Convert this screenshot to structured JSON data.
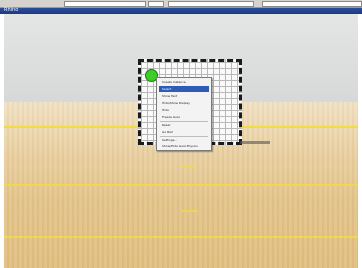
{
  "window": {
    "title": "Rhino"
  },
  "context_menu": {
    "items": [
      {
        "label": "Create Instance"
      },
      {
        "label": "Select"
      },
      {
        "label": "Show Text"
      },
      {
        "label": "Hide/Show Display"
      },
      {
        "label": "Hide"
      },
      {
        "label": "Freeze Goal"
      },
      {
        "label": "Reset"
      },
      {
        "label": "Go Ball"
      },
      {
        "label": "Settings..."
      },
      {
        "label": "Show/Hide Goal Physics"
      }
    ],
    "selected_index": 1
  },
  "colors": {
    "titlebar": "#1b3a80",
    "court_lines": "#f1dc43",
    "ball": "#3dcc2a",
    "menu_selection": "#2f5db5"
  }
}
